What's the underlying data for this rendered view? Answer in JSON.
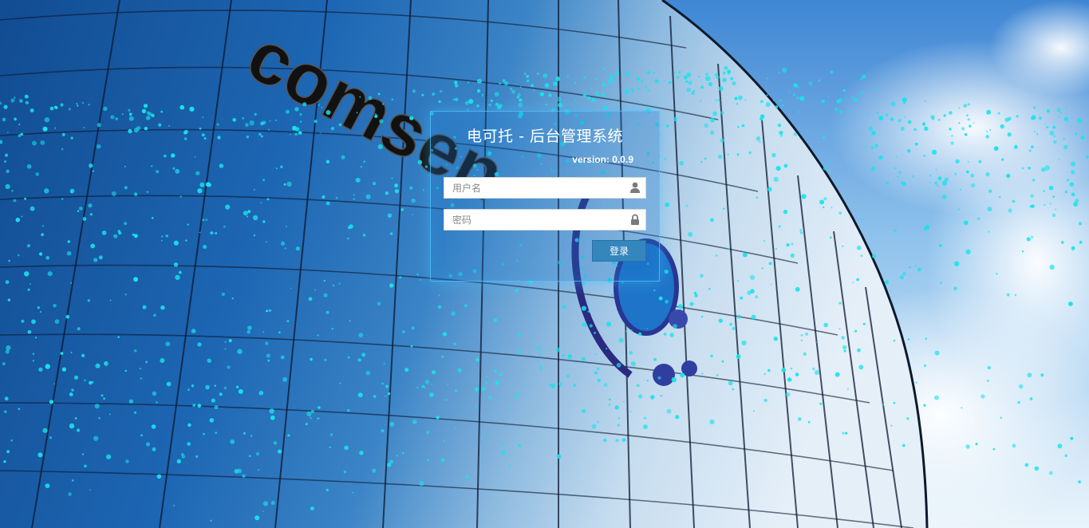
{
  "login": {
    "title": "电可托 - 后台管理系统",
    "version": "version: 0.0.9",
    "username_placeholder": "用户名",
    "password_placeholder": "密码",
    "submit_label": "登录"
  },
  "background": {
    "building_logo_text": "comsen",
    "sky_color": "#5a9ede",
    "glass_color": "#1c5fa6",
    "particle_color": "#19e3ec"
  },
  "icons": {
    "username": "user-icon",
    "password": "lock-icon"
  }
}
